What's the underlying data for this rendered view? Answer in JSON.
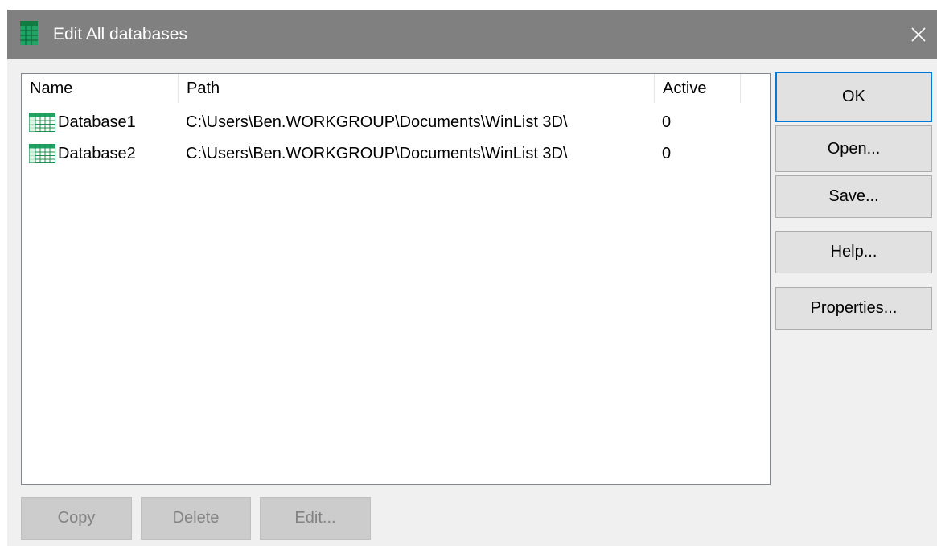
{
  "window": {
    "title": "Edit All databases",
    "app_icon": "database-table-icon",
    "close_icon": "close-icon"
  },
  "list": {
    "columns": {
      "name": "Name",
      "path": "Path",
      "active": "Active"
    },
    "rows": [
      {
        "icon": "database-table-icon",
        "name": "Database1",
        "path": "C:\\Users\\Ben.WORKGROUP\\Documents\\WinList 3D\\",
        "active": "0"
      },
      {
        "icon": "database-table-icon",
        "name": "Database2",
        "path": "C:\\Users\\Ben.WORKGROUP\\Documents\\WinList 3D\\",
        "active": "0"
      }
    ]
  },
  "buttons": {
    "ok": "OK",
    "open": "Open...",
    "save": "Save...",
    "help": "Help...",
    "properties": "Properties...",
    "copy": "Copy",
    "delete": "Delete",
    "edit": "Edit..."
  },
  "colors": {
    "titlebar": "#808080",
    "dialog_bg": "#f0f0f0",
    "default_button_border": "#0078d7",
    "disabled_text": "#838383",
    "icon_green": "#21a366"
  }
}
